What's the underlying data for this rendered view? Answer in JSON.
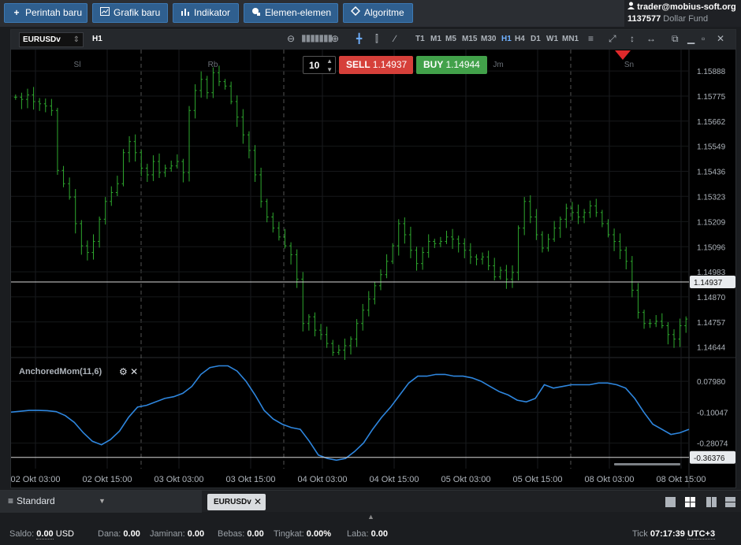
{
  "toolbar": {
    "new_order": "Perintah baru",
    "new_chart": "Grafik baru",
    "indicators": "Indikator",
    "elements": "Elemen-elemen",
    "algorithm": "Algoritme"
  },
  "account": {
    "user": "trader@mobius-soft.org",
    "number": "1137577",
    "fund": "Dollar Fund"
  },
  "chart_toolbar": {
    "symbol": "EURUSDv",
    "timeframe": "H1",
    "timeframes": [
      "T1",
      "M1",
      "M5",
      "M15",
      "M30",
      "H1",
      "H4",
      "D1",
      "W1",
      "MN1"
    ],
    "active_timeframe": "H1"
  },
  "trade": {
    "quantity": "10",
    "sell_label": "SELL",
    "sell_price": "1.14937",
    "buy_label": "BUY",
    "buy_price": "1.14944"
  },
  "chart_data": [
    {
      "type": "candlestick",
      "symbol": "EURUSDv",
      "timeframe": "H1",
      "y_ticks": [
        "1.15888",
        "1.15775",
        "1.15662",
        "1.15549",
        "1.15436",
        "1.15323",
        "1.15209",
        "1.15096",
        "1.14983",
        "1.14870",
        "1.14757",
        "1.14644"
      ],
      "ylim": [
        1.146,
        1.1597
      ],
      "current_price": "1.14937",
      "session_labels": [
        "Sl",
        "Rb",
        "Jm",
        "Sn"
      ],
      "x_ticks": [
        "02 Okt 03:00",
        "02 Okt 15:00",
        "03 Okt 03:00",
        "03 Okt 15:00",
        "04 Okt 03:00",
        "04 Okt 15:00",
        "05 Okt 03:00",
        "05 Okt 15:00",
        "08 Okt 03:00",
        "08 Okt 15:00"
      ],
      "close": [
        1.1577,
        1.1576,
        1.1578,
        1.1575,
        1.1574,
        1.1573,
        1.1571,
        1.1544,
        1.1538,
        1.1532,
        1.152,
        1.151,
        1.1507,
        1.1512,
        1.1522,
        1.153,
        1.1534,
        1.1538,
        1.1552,
        1.1557,
        1.1552,
        1.1545,
        1.1542,
        1.1548,
        1.1543,
        1.1545,
        1.1546,
        1.1548,
        1.1543,
        1.1571,
        1.158,
        1.1585,
        1.1579,
        1.1588,
        1.1584,
        1.1582,
        1.1575,
        1.1568,
        1.156,
        1.1553,
        1.1542,
        1.153,
        1.1523,
        1.1518,
        1.1514,
        1.151,
        1.1506,
        1.1495,
        1.1475,
        1.1478,
        1.1472,
        1.147,
        1.1466,
        1.1462,
        1.1463,
        1.1465,
        1.1468,
        1.1475,
        1.1481,
        1.1486,
        1.1492,
        1.1497,
        1.1503,
        1.151,
        1.152,
        1.1515,
        1.1508,
        1.1502,
        1.1507,
        1.1512,
        1.1511,
        1.1512,
        1.1514,
        1.1513,
        1.1511,
        1.1508,
        1.1505,
        1.1504,
        1.1505,
        1.1501,
        1.1496,
        1.1499,
        1.1495,
        1.1498,
        1.1518,
        1.153,
        1.1523,
        1.1515,
        1.1509,
        1.1513,
        1.1518,
        1.1522,
        1.1527,
        1.1525,
        1.1523,
        1.1525,
        1.1528,
        1.1525,
        1.152,
        1.1515,
        1.1512,
        1.1508,
        1.1503,
        1.149,
        1.148,
        1.1475,
        1.1475,
        1.1476,
        1.1474,
        1.147,
        1.1468,
        1.1474,
        1.1477
      ]
    },
    {
      "type": "line",
      "title": "AnchoredMom(11,6)",
      "y_ticks": [
        "0.07980",
        "-0.10047",
        "-0.28074",
        "-0.36376"
      ],
      "ylim": [
        -0.42,
        0.2
      ],
      "current_value": "-0.36376",
      "values": [
        -0.1,
        -0.095,
        -0.09,
        -0.09,
        -0.091,
        -0.097,
        -0.12,
        -0.16,
        -0.22,
        -0.27,
        -0.29,
        -0.26,
        -0.21,
        -0.13,
        -0.07,
        -0.06,
        -0.04,
        -0.02,
        -0.01,
        0.01,
        0.05,
        0.12,
        0.16,
        0.17,
        0.17,
        0.14,
        0.08,
        0.0,
        -0.09,
        -0.14,
        -0.17,
        -0.19,
        -0.2,
        -0.27,
        -0.35,
        -0.37,
        -0.38,
        -0.37,
        -0.33,
        -0.28,
        -0.2,
        -0.13,
        -0.07,
        0.0,
        0.07,
        0.11,
        0.11,
        0.12,
        0.12,
        0.11,
        0.11,
        0.1,
        0.08,
        0.05,
        0.02,
        0.0,
        -0.03,
        -0.04,
        -0.02,
        0.06,
        0.04,
        0.05,
        0.06,
        0.06,
        0.06,
        0.07,
        0.07,
        0.06,
        0.04,
        -0.02,
        -0.1,
        -0.17,
        -0.2,
        -0.23,
        -0.22,
        -0.2
      ]
    }
  ],
  "bottom": {
    "workspace": "Standard",
    "chart_tab": "EURUSDv"
  },
  "status": {
    "saldo_label": "Saldo:",
    "saldo_value": "0.00",
    "currency": "USD",
    "dana_label": "Dana:",
    "dana_value": "0.00",
    "jaminan_label": "Jaminan:",
    "jaminan_value": "0.00",
    "bebas_label": "Bebas:",
    "bebas_value": "0.00",
    "tingkat_label": "Tingkat:",
    "tingkat_value": "0.00%",
    "laba_label": "Laba:",
    "laba_value": "0.00",
    "tick_label": "Tick",
    "time": "07:17:39",
    "timezone": "UTC+3"
  }
}
